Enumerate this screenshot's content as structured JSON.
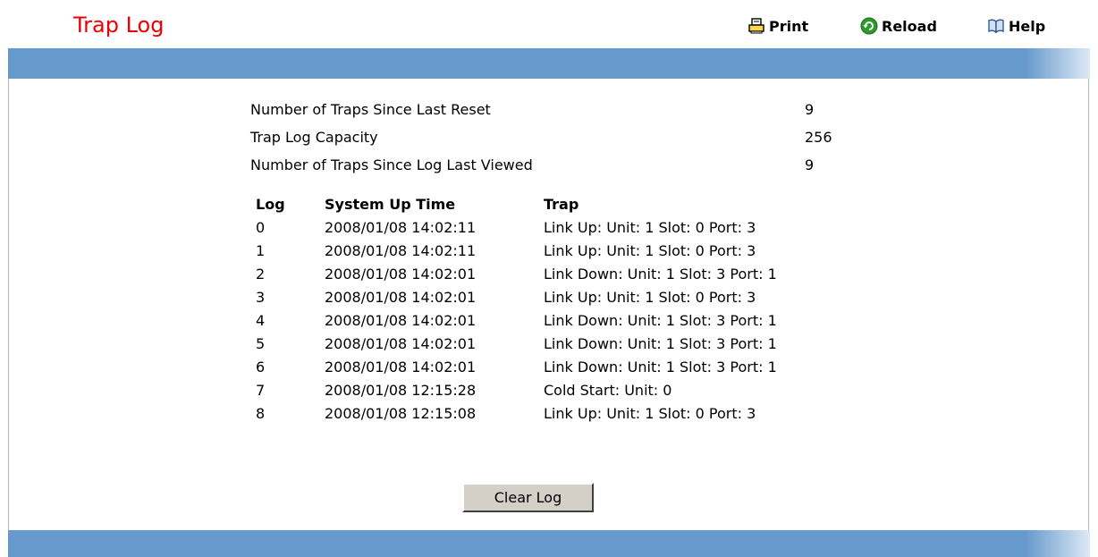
{
  "header": {
    "title": "Trap Log",
    "actions": {
      "print": {
        "label": "Print",
        "icon": "printer-icon"
      },
      "reload": {
        "label": "Reload",
        "icon": "reload-icon"
      },
      "help": {
        "label": "Help",
        "icon": "help-book-icon"
      }
    },
    "title_color": "#ee0000",
    "band_color": "#6699cc"
  },
  "summary": [
    {
      "label": "Number of Traps Since Last Reset",
      "value": "9"
    },
    {
      "label": "Trap Log Capacity",
      "value": "256"
    },
    {
      "label": "Number of Traps Since Log Last Viewed",
      "value": "9"
    }
  ],
  "log_table": {
    "columns": [
      "Log",
      "System Up Time",
      "Trap"
    ],
    "rows": [
      [
        "0",
        "2008/01/08 14:02:11",
        "Link Up: Unit: 1 Slot: 0 Port: 3"
      ],
      [
        "1",
        "2008/01/08 14:02:11",
        "Link Up: Unit: 1 Slot: 0 Port: 3"
      ],
      [
        "2",
        "2008/01/08 14:02:01",
        "Link Down: Unit: 1 Slot: 3 Port: 1"
      ],
      [
        "3",
        "2008/01/08 14:02:01",
        "Link Up: Unit: 1 Slot: 0 Port: 3"
      ],
      [
        "4",
        "2008/01/08 14:02:01",
        "Link Down: Unit: 1 Slot: 3 Port: 1"
      ],
      [
        "5",
        "2008/01/08 14:02:01",
        "Link Down: Unit: 1 Slot: 3 Port: 1"
      ],
      [
        "6",
        "2008/01/08 14:02:01",
        "Link Down: Unit: 1 Slot: 3 Port: 1"
      ],
      [
        "7",
        "2008/01/08 12:15:28",
        "Cold Start: Unit: 0"
      ],
      [
        "8",
        "2008/01/08 12:15:08",
        "Link Up: Unit: 1 Slot: 0 Port: 3"
      ]
    ]
  },
  "buttons": {
    "clear_log": "Clear Log"
  }
}
